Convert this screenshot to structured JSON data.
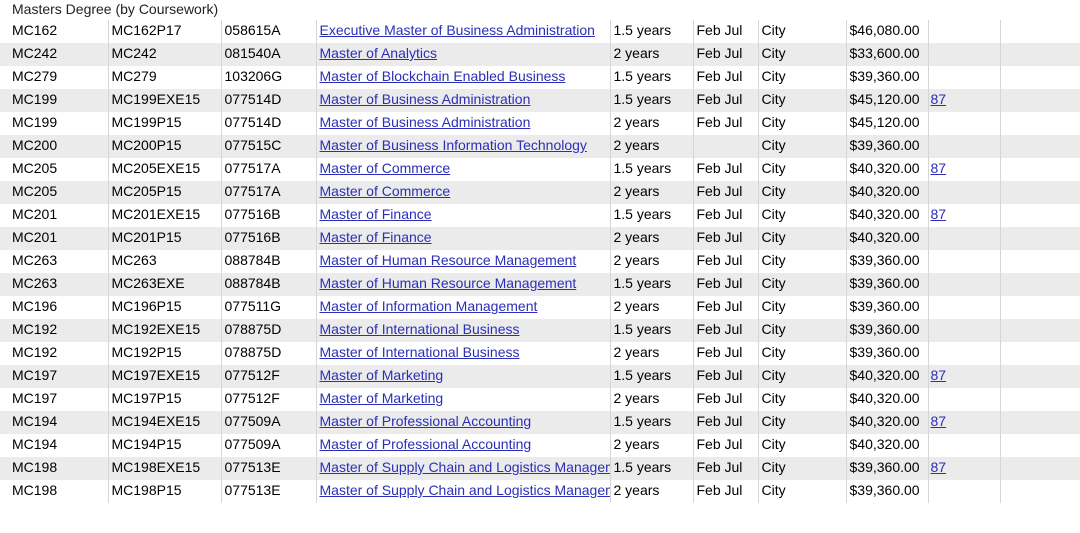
{
  "caption": "Masters Degree (by Coursework)",
  "rows": [
    {
      "code": "MC162",
      "plan": "MC162P17",
      "cricos": "058615A",
      "name": "Executive Master of Business Administration",
      "duration": "1.5 years",
      "intake": "Feb Jul",
      "campus": "City",
      "fee": "$46,080.00",
      "note": ""
    },
    {
      "code": "MC242",
      "plan": "MC242",
      "cricos": "081540A",
      "name": "Master of Analytics",
      "duration": "2 years",
      "intake": "Feb Jul",
      "campus": "City",
      "fee": "$33,600.00",
      "note": ""
    },
    {
      "code": "MC279",
      "plan": "MC279",
      "cricos": "103206G",
      "name": "Master of Blockchain Enabled Business",
      "duration": "1.5 years",
      "intake": "Feb Jul",
      "campus": "City",
      "fee": "$39,360.00",
      "note": ""
    },
    {
      "code": "MC199",
      "plan": "MC199EXE15",
      "cricos": "077514D",
      "name": "Master of Business Administration",
      "duration": "1.5 years",
      "intake": "Feb Jul",
      "campus": "City",
      "fee": "$45,120.00",
      "note": "87"
    },
    {
      "code": "MC199",
      "plan": "MC199P15",
      "cricos": "077514D",
      "name": "Master of Business Administration",
      "duration": "2 years",
      "intake": "Feb Jul",
      "campus": "City",
      "fee": "$45,120.00",
      "note": ""
    },
    {
      "code": "MC200",
      "plan": "MC200P15",
      "cricos": "077515C",
      "name": "Master of Business Information Technology",
      "duration": "2 years",
      "intake": "",
      "campus": "City",
      "fee": "$39,360.00",
      "note": ""
    },
    {
      "code": "MC205",
      "plan": "MC205EXE15",
      "cricos": "077517A",
      "name": "Master of Commerce",
      "duration": "1.5 years",
      "intake": "Feb Jul",
      "campus": "City",
      "fee": "$40,320.00",
      "note": "87"
    },
    {
      "code": "MC205",
      "plan": "MC205P15",
      "cricos": "077517A",
      "name": "Master of Commerce",
      "duration": "2 years",
      "intake": "Feb Jul",
      "campus": "City",
      "fee": "$40,320.00",
      "note": ""
    },
    {
      "code": "MC201",
      "plan": "MC201EXE15",
      "cricos": "077516B",
      "name": "Master of Finance",
      "duration": "1.5 years",
      "intake": "Feb Jul",
      "campus": "City",
      "fee": "$40,320.00",
      "note": "87"
    },
    {
      "code": "MC201",
      "plan": "MC201P15",
      "cricos": "077516B",
      "name": "Master of Finance",
      "duration": "2 years",
      "intake": "Feb Jul",
      "campus": "City",
      "fee": "$40,320.00",
      "note": ""
    },
    {
      "code": "MC263",
      "plan": "MC263",
      "cricos": "088784B",
      "name": "Master of Human Resource Management",
      "duration": "2 years",
      "intake": "Feb Jul",
      "campus": "City",
      "fee": "$39,360.00",
      "note": ""
    },
    {
      "code": "MC263",
      "plan": "MC263EXE",
      "cricos": "088784B",
      "name": "Master of Human Resource Management",
      "duration": "1.5 years",
      "intake": "Feb Jul",
      "campus": "City",
      "fee": "$39,360.00",
      "note": ""
    },
    {
      "code": "MC196",
      "plan": "MC196P15",
      "cricos": "077511G",
      "name": "Master of Information Management",
      "duration": "2 years",
      "intake": "Feb Jul",
      "campus": "City",
      "fee": "$39,360.00",
      "note": ""
    },
    {
      "code": "MC192",
      "plan": "MC192EXE15",
      "cricos": "078875D",
      "name": "Master of International Business",
      "duration": "1.5 years",
      "intake": "Feb Jul",
      "campus": "City",
      "fee": "$39,360.00",
      "note": ""
    },
    {
      "code": "MC192",
      "plan": "MC192P15",
      "cricos": "078875D",
      "name": "Master of International Business",
      "duration": "2 years",
      "intake": "Feb Jul",
      "campus": "City",
      "fee": "$39,360.00",
      "note": ""
    },
    {
      "code": "MC197",
      "plan": "MC197EXE15",
      "cricos": "077512F",
      "name": "Master of Marketing",
      "duration": "1.5 years",
      "intake": "Feb Jul",
      "campus": "City",
      "fee": "$40,320.00",
      "note": "87"
    },
    {
      "code": "MC197",
      "plan": "MC197P15",
      "cricos": "077512F",
      "name": "Master of Marketing",
      "duration": "2 years",
      "intake": "Feb Jul",
      "campus": "City",
      "fee": "$40,320.00",
      "note": ""
    },
    {
      "code": "MC194",
      "plan": "MC194EXE15",
      "cricos": "077509A",
      "name": "Master of Professional Accounting",
      "duration": "1.5 years",
      "intake": "Feb Jul",
      "campus": "City",
      "fee": "$40,320.00",
      "note": "87"
    },
    {
      "code": "MC194",
      "plan": "MC194P15",
      "cricos": "077509A",
      "name": "Master of Professional Accounting",
      "duration": "2 years",
      "intake": "Feb Jul",
      "campus": "City",
      "fee": "$40,320.00",
      "note": ""
    },
    {
      "code": "MC198",
      "plan": "MC198EXE15",
      "cricos": "077513E",
      "name": "Master of Supply Chain and Logistics Management",
      "duration": "1.5 years",
      "intake": "Feb Jul",
      "campus": "City",
      "fee": "$39,360.00",
      "note": "87"
    },
    {
      "code": "MC198",
      "plan": "MC198P15",
      "cricos": "077513E",
      "name": "Master of Supply Chain and Logistics Management",
      "duration": "2 years",
      "intake": "Feb Jul",
      "campus": "City",
      "fee": "$39,360.00",
      "note": ""
    }
  ]
}
